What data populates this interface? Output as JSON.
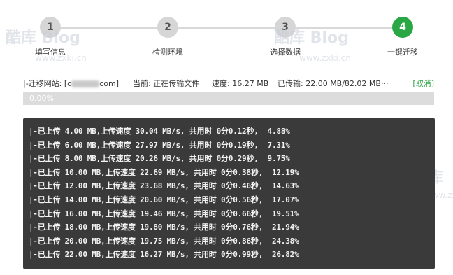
{
  "steps": [
    {
      "number": "1",
      "label": "填写信息",
      "active": false
    },
    {
      "number": "2",
      "label": "检测环境",
      "active": false
    },
    {
      "number": "3",
      "label": "选择数据",
      "active": false
    },
    {
      "number": "4",
      "label": "一键迁移",
      "active": true
    }
  ],
  "watermarks": {
    "brand": "酷库 Blog",
    "url": "www.zxki.cn",
    "brand_short": "酷库",
    "url_short": "www.zx"
  },
  "status": {
    "site_prefix": "|-迁移网站: [c",
    "site_suffix": "com]",
    "current": "当前: 正在传输文件",
    "speed": "速度: 16.27 MB",
    "transferred": "已传输: 22.00 MB/82.02 MB···",
    "cancel": "[取消]"
  },
  "progress": {
    "label": "0.00%",
    "value": 0.0
  },
  "colors": {
    "accent": "#2aa745",
    "console_bg": "#3a3a3a",
    "inactive_step": "#d6d6d6"
  },
  "log_lines": [
    "|-已上传 4.00 MB,上传速度 30.04 MB/s, 共用时 0分0.12秒,  4.88%",
    "|-已上传 6.00 MB,上传速度 27.97 MB/s, 共用时 0分0.19秒,  7.31%",
    "|-已上传 8.00 MB,上传速度 20.26 MB/s, 共用时 0分0.29秒,  9.75%",
    "|-已上传 10.00 MB,上传速度 22.69 MB/s, 共用时 0分0.38秒,  12.19%",
    "|-已上传 12.00 MB,上传速度 23.68 MB/s, 共用时 0分0.46秒,  14.63%",
    "|-已上传 14.00 MB,上传速度 20.60 MB/s, 共用时 0分0.56秒,  17.07%",
    "|-已上传 16.00 MB,上传速度 19.46 MB/s, 共用时 0分0.66秒,  19.51%",
    "|-已上传 18.00 MB,上传速度 19.80 MB/s, 共用时 0分0.76秒,  21.94%",
    "|-已上传 20.00 MB,上传速度 19.75 MB/s, 共用时 0分0.86秒,  24.38%",
    "|-已上传 22.00 MB,上传速度 16.27 MB/s, 共用时 0分0.99秒,  26.82%"
  ]
}
